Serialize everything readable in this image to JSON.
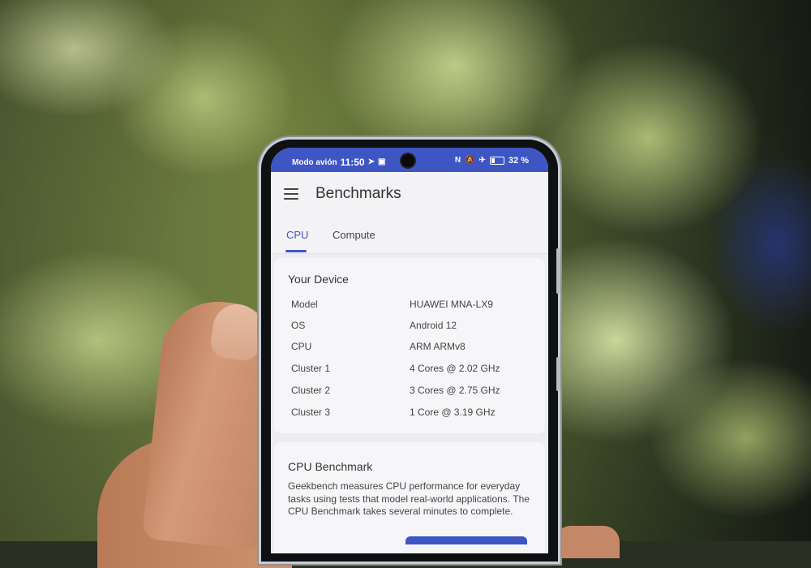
{
  "status_bar": {
    "mode": "Modo avión",
    "time": "11:50",
    "battery": "32 %",
    "battery_level": 0.32
  },
  "app_bar": {
    "title": "Benchmarks"
  },
  "tabs": [
    {
      "label": "CPU",
      "active": true
    },
    {
      "label": "Compute",
      "active": false
    }
  ],
  "device": {
    "heading": "Your Device",
    "rows": [
      {
        "key": "Model",
        "value": "HUAWEI MNA-LX9"
      },
      {
        "key": "OS",
        "value": "Android 12"
      },
      {
        "key": "CPU",
        "value": "ARM ARMv8"
      },
      {
        "key": "Cluster 1",
        "value": "4 Cores @ 2.02 GHz"
      },
      {
        "key": "Cluster 2",
        "value": "3 Cores @ 2.75 GHz"
      },
      {
        "key": "Cluster 3",
        "value": "1 Core @ 3.19 GHz"
      }
    ]
  },
  "cpu_benchmark": {
    "heading": "CPU Benchmark",
    "description": "Geekbench measures CPU performance for everyday tasks using tests that model real-world applications. The CPU Benchmark takes several minutes to complete."
  },
  "colors": {
    "accent": "#3e55c4",
    "screen_bg": "#f3f3f6"
  },
  "icons": [
    "menu-icon",
    "telegram-icon",
    "app-notification-icon",
    "nfc-icon",
    "mute-icon",
    "airplane-icon",
    "battery-icon"
  ]
}
